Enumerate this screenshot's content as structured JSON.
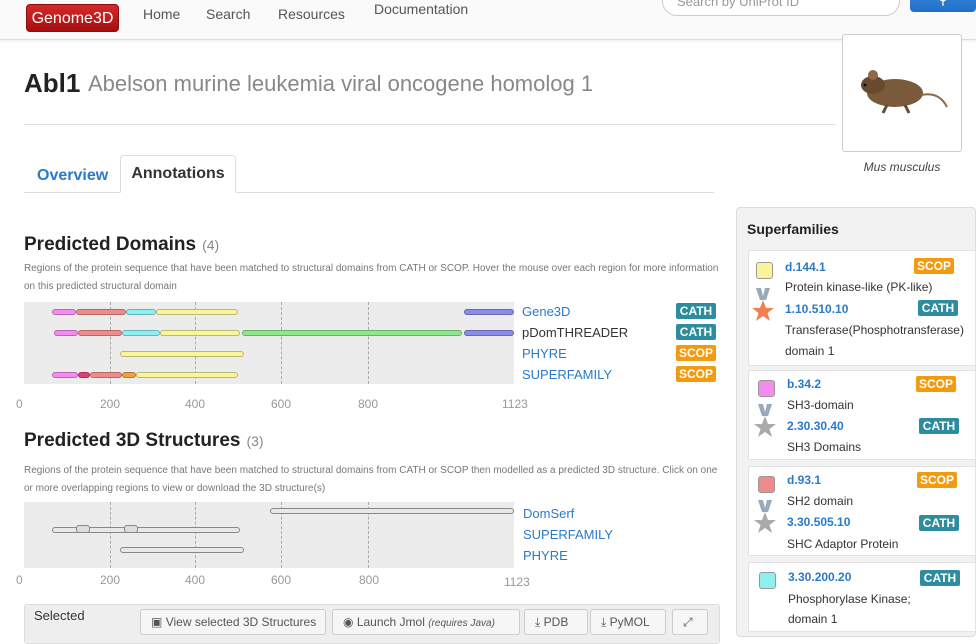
{
  "nav": {
    "brand": "Genome3D",
    "items": [
      "Home",
      "Search",
      "Resources",
      "Documentation"
    ],
    "search_placeholder": "Search by UniProt ID"
  },
  "gene": {
    "symbol": "Abl1",
    "name": "Abelson murine leukemia viral oncogene homolog 1",
    "species": "Mus musculus"
  },
  "tabs": [
    "Overview",
    "Annotations"
  ],
  "domains": {
    "title": "Predicted Domains",
    "count": "(4)",
    "desc": "Regions of the protein sequence that have been matched to structural domains from CATH or SCOP. Hover the mouse over each region for more information on this predicted structural domain",
    "rows": [
      {
        "label": "Gene3D",
        "badge": "CATH"
      },
      {
        "label": "pDomTHREADER",
        "badge": "CATH"
      },
      {
        "label": "PHYRE",
        "badge": "SCOP"
      },
      {
        "label": "SUPERFAMILY",
        "badge": "SCOP"
      }
    ],
    "ticks": [
      "0",
      "200",
      "400",
      "600",
      "800",
      "1123"
    ]
  },
  "structures": {
    "title": "Predicted 3D Structures",
    "count": "(3)",
    "desc": "Regions of the protein sequence that have been matched to structural domains from CATH or SCOP then modelled as a predicted 3D structure. Click on one or more overlapping regions to view or download the 3D structure(s)",
    "rows": [
      "DomSerf",
      "SUPERFAMILY",
      "PHYRE"
    ],
    "ticks": [
      "0",
      "200",
      "400",
      "600",
      "800",
      "1123"
    ]
  },
  "superfamilies": {
    "title": "Superfamilies",
    "items": [
      {
        "code1": "d.144.1",
        "badge1": "SCOP",
        "text1": "Protein kinase-like (PK-like)",
        "code2": "1.10.510.10",
        "badge2": "CATH",
        "text2": "Transferase(Phosphotransferase)",
        "text3": "domain 1",
        "color": "#fbf59a"
      },
      {
        "code1": "b.34.2",
        "badge1": "SCOP",
        "text1": "SH3-domain",
        "code2": "2.30.30.40",
        "badge2": "CATH",
        "text2": "SH3 Domains",
        "color": "#f58bf0"
      },
      {
        "code1": "d.93.1",
        "badge1": "SCOP",
        "text1": "SH2 domain",
        "code2": "3.30.505.10",
        "badge2": "CATH",
        "text2": "SHC Adaptor Protein",
        "color": "#f08b8b"
      },
      {
        "code1": "3.30.200.20",
        "badge1": "CATH",
        "text1": "Phosphorylase Kinase;",
        "text2": "domain 1",
        "color": "#8ff0ef"
      }
    ]
  },
  "toolbar": {
    "selected": "Selected",
    "view": "View selected 3D Structures",
    "jmol": "Launch Jmol",
    "jmol_note": "(requires Java)",
    "pdb": "PDB",
    "pymol": "PyMOL"
  }
}
